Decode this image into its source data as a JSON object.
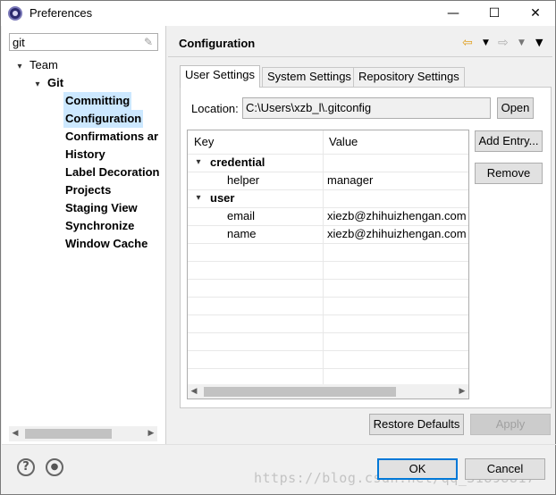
{
  "window": {
    "title": "Preferences",
    "controls": {
      "minimize": "—",
      "maximize": "☐",
      "close": "✕"
    }
  },
  "sidebar": {
    "filter_value": "git",
    "tree": {
      "team": {
        "label": "Team",
        "expanded": true
      },
      "git": {
        "label": "Git",
        "expanded": true
      },
      "items": [
        {
          "label": "Committing",
          "highlight": true
        },
        {
          "label": "Configuration",
          "selected": true
        },
        {
          "label": "Confirmations ar"
        },
        {
          "label": "History"
        },
        {
          "label": "Label Decoration"
        },
        {
          "label": "Projects"
        },
        {
          "label": "Staging View"
        },
        {
          "label": "Synchronize"
        },
        {
          "label": "Window Cache"
        }
      ]
    }
  },
  "main": {
    "title": "Configuration",
    "nav": {
      "back_icon": "back-arrow-icon",
      "forward_icon": "forward-arrow-icon",
      "menu_icon": "view-menu-icon"
    },
    "tabs": [
      {
        "label": "User Settings",
        "active": true
      },
      {
        "label": "System Settings",
        "active": false
      },
      {
        "label": "Repository Settings",
        "active": false
      }
    ],
    "location": {
      "label": "Location:",
      "value": "C:\\Users\\xzb_l\\.gitconfig",
      "open_button": "Open"
    },
    "table": {
      "columns": [
        "Key",
        "Value"
      ],
      "rows": [
        {
          "key": "credential",
          "value": "",
          "section": true
        },
        {
          "key": "helper",
          "value": "manager",
          "section": false
        },
        {
          "key": "user",
          "value": "",
          "section": true
        },
        {
          "key": "email",
          "value": "xiezb@zhihuizhengan.com",
          "section": false
        },
        {
          "key": "name",
          "value": "xiezb@zhihuizhengan.com",
          "section": false
        }
      ]
    },
    "side_buttons": {
      "add_entry": "Add Entry...",
      "remove": "Remove"
    },
    "restore_defaults": "Restore Defaults",
    "apply": "Apply"
  },
  "footer": {
    "help_icon": "help-icon",
    "import_export_icon": "import-export-icon",
    "ok": "OK",
    "cancel": "Cancel",
    "watermark": "https://blog.csdn.net/qq_31898817"
  },
  "colors": {
    "selection": "#cce8ff",
    "focus_border": "#0078d7",
    "window_bg": "#f0f0f0"
  }
}
